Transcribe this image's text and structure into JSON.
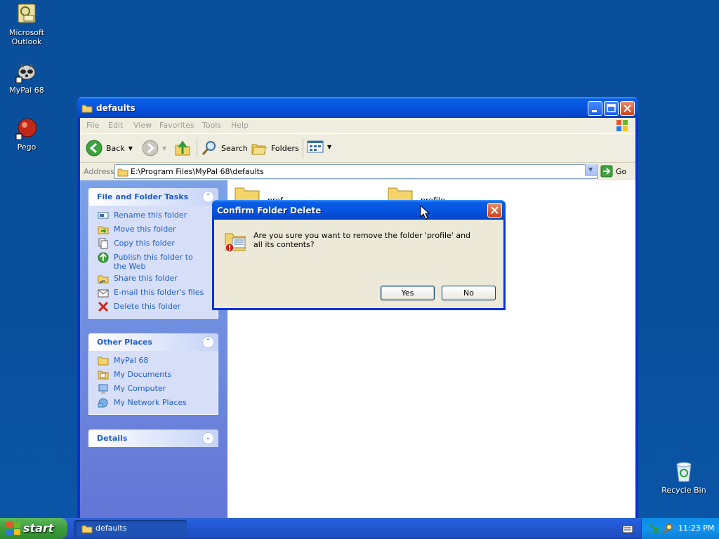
{
  "desktop": {
    "icons": [
      {
        "label_line1": "Microsoft",
        "label_line2": "Outlook"
      },
      {
        "label_line1": "MyPal 68",
        "label_line2": ""
      },
      {
        "label_line1": "Pego",
        "label_line2": ""
      },
      {
        "label_line1": "Recycle Bin",
        "label_line2": ""
      }
    ]
  },
  "window": {
    "title": "defaults",
    "menu": [
      "File",
      "Edit",
      "View",
      "Favorites",
      "Tools",
      "Help"
    ],
    "toolbar": {
      "back": "Back",
      "search": "Search",
      "folders": "Folders"
    },
    "address": {
      "label": "Address",
      "value": "E:\\Program Files\\MyPal 68\\defaults",
      "go": "Go"
    },
    "tasks_panel": {
      "title": "File and Folder Tasks",
      "items": [
        "Rename this folder",
        "Move this folder",
        "Copy this folder",
        "Publish this folder to the Web",
        "Share this folder",
        "E-mail this folder's files",
        "Delete this folder"
      ]
    },
    "places_panel": {
      "title": "Other Places",
      "items": [
        "MyPal 68",
        "My Documents",
        "My Computer",
        "My Network Places"
      ]
    },
    "details_panel": {
      "title": "Details"
    },
    "folders": [
      "pref",
      "profile"
    ]
  },
  "dialog": {
    "title": "Confirm Folder Delete",
    "message": "Are you sure you want to remove the folder 'profile' and all its contents?",
    "yes": "Yes",
    "no": "No"
  },
  "taskbar": {
    "start": "start",
    "task": "defaults",
    "clock": "11:23 PM"
  },
  "colors": {
    "desktop": "#0a4f9c",
    "title_blue": "#0655e0",
    "link_blue": "#215dc6"
  }
}
